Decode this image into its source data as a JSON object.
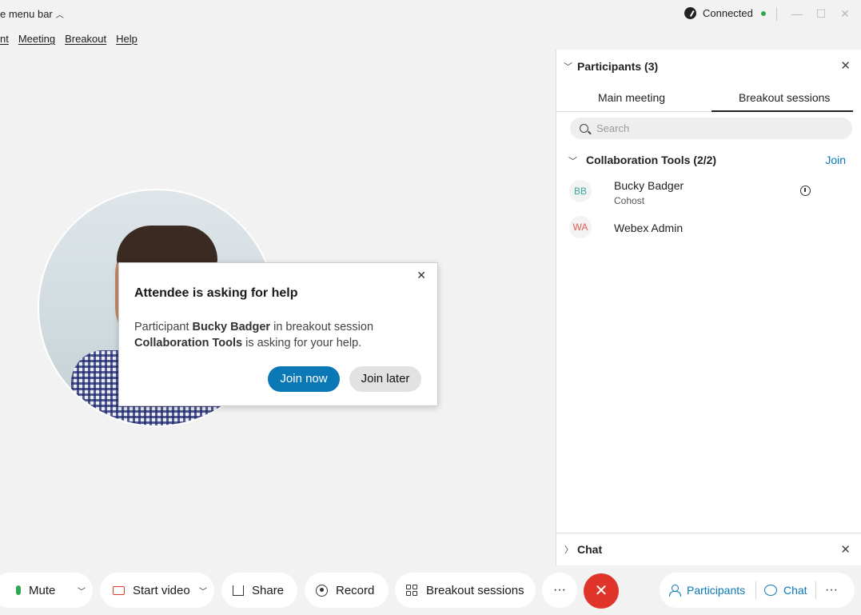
{
  "titlebar": {
    "hide_menu_label": "e menu bar",
    "status": "Connected",
    "minimize": "—",
    "maximize": "☐",
    "close": "✕"
  },
  "menubar": {
    "items": [
      "nt",
      "Meeting",
      "Breakout",
      "Help"
    ]
  },
  "dialog": {
    "title": "Attendee is asking for help",
    "body_prefix": "Participant ",
    "participant": "Bucky Badger",
    "body_mid": " in breakout session ",
    "session": "Collaboration Tools",
    "body_suffix": " is asking for your help.",
    "join_now": "Join now",
    "join_later": "Join later"
  },
  "participants_panel": {
    "title": "Participants (3)",
    "tabs": [
      "Main meeting",
      "Breakout sessions"
    ],
    "active_tab": "Breakout sessions",
    "search_placeholder": "Search",
    "group": {
      "name": "Collaboration Tools (2/2)",
      "join_label": "Join",
      "members": [
        {
          "initials": "BB",
          "name": "Bucky Badger",
          "role": "Cohost",
          "initials_color": "#3aa89b"
        },
        {
          "initials": "WA",
          "name": "Webex Admin",
          "role": "",
          "initials_color": "#e05a4f"
        }
      ]
    }
  },
  "chat_panel": {
    "title": "Chat"
  },
  "toolbar": {
    "mute": "Mute",
    "start_video": "Start video",
    "share": "Share",
    "record": "Record",
    "breakout_sessions": "Breakout sessions",
    "more": "···",
    "end": "✕",
    "participants": "Participants",
    "chat": "Chat",
    "overflow": "···"
  },
  "colors": {
    "accent": "#0a78b5",
    "end_call": "#e0342b",
    "connected": "#2fa84f"
  }
}
